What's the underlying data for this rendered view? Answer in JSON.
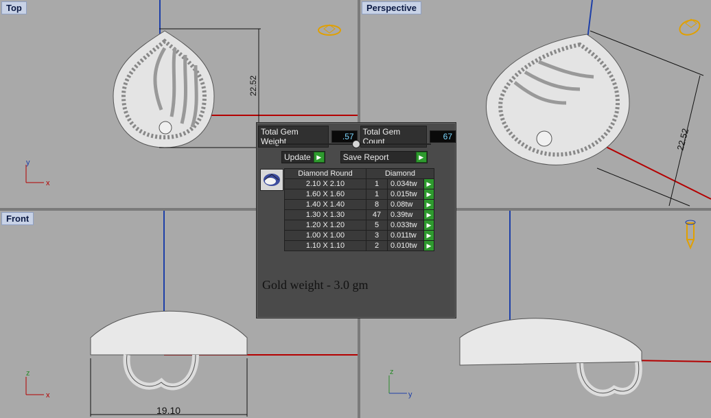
{
  "viewports": {
    "top": {
      "title": "Top",
      "dimension": "22.52",
      "axis1": "y",
      "axis2": "x"
    },
    "perspective": {
      "title": "Perspective",
      "dimension": "22.52"
    },
    "front": {
      "title": "Front",
      "dimension": "19.10",
      "axis1": "z",
      "axis2": "x"
    },
    "right": {
      "axis1": "z",
      "axis2": "y"
    }
  },
  "gem_panel": {
    "total_weight_label": "Total Gem Weight",
    "total_weight_value": ".57",
    "total_count_label": "Total Gem Count",
    "total_count_value": "67",
    "update_label": "Update",
    "save_report_label": "Save Report",
    "table": {
      "header_shape": "Diamond Round",
      "header_material": "Diamond",
      "rows": [
        {
          "size": "2.10 X 2.10",
          "count": "1",
          "tw": "0.034tw"
        },
        {
          "size": "1.60 X 1.60",
          "count": "1",
          "tw": "0.015tw"
        },
        {
          "size": "1.40 X 1.40",
          "count": "8",
          "tw": "0.08tw"
        },
        {
          "size": "1.30 X 1.30",
          "count": "47",
          "tw": "0.39tw"
        },
        {
          "size": "1.20 X 1.20",
          "count": "5",
          "tw": "0.033tw"
        },
        {
          "size": "1.00 X 1.00",
          "count": "3",
          "tw": "0.011tw"
        },
        {
          "size": "1.10 X 1.10",
          "count": "2",
          "tw": "0.010tw"
        }
      ]
    },
    "gold_weight": "Gold weight - 3.0 gm"
  },
  "colors": {
    "viewport_bg": "#a9a9a9",
    "axis_red": "#b40000",
    "axis_blue": "#1d3fa8",
    "panel_bg": "#4a4a4a",
    "go_green": "#2e9a2e"
  }
}
